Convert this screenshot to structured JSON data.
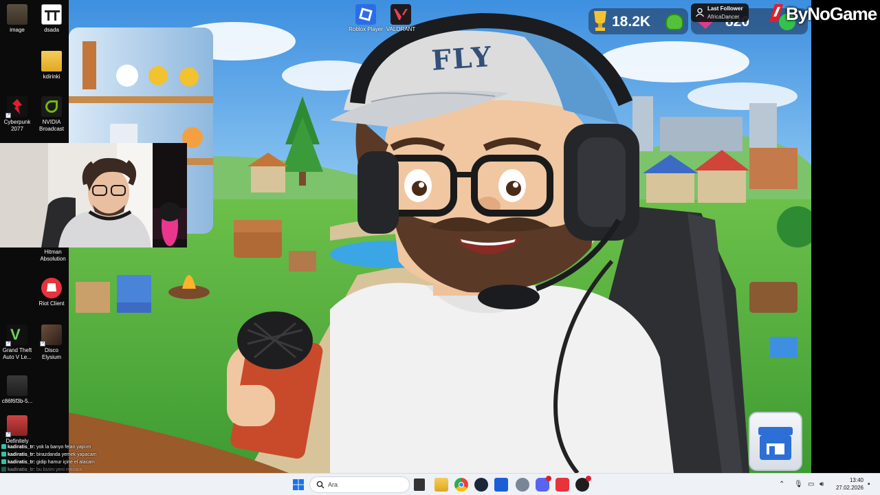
{
  "desktop_left_icons": [
    {
      "label": "image",
      "icon": "image-file-icon"
    },
    {
      "label": "dsada",
      "icon": "dsada-icon"
    },
    {
      "label": "kdirinki",
      "icon": "folder-icon"
    },
    {
      "label": "Cyberpunk 2077",
      "icon": "cyberpunk-icon"
    },
    {
      "label": "NVIDIA Broadcast",
      "icon": "nvidia-icon"
    },
    {
      "label": "Hitman Absolution",
      "icon": "hitman-icon"
    },
    {
      "label": "Riot Client",
      "icon": "riot-icon"
    },
    {
      "label": "Grand Theft Auto V Le...",
      "icon": "gta-icon"
    },
    {
      "label": "Disco Elysium",
      "icon": "disco-elysium-icon"
    },
    {
      "label": "c86f6f3b-5...",
      "icon": "image-file-icon"
    },
    {
      "label": "Definitely",
      "icon": "definitely-icon"
    }
  ],
  "desktop_top_icons": [
    {
      "label": "Roblox Player",
      "icon": "roblox-icon",
      "color": "#2b6de6"
    },
    {
      "label": "VALORANT",
      "icon": "valorant-icon",
      "color": "#e84057"
    }
  ],
  "hud": {
    "gold_value": "18.2K",
    "gem_value": "820"
  },
  "follower": {
    "title": "Last Follower",
    "name": "AfricaDancer"
  },
  "logo": {
    "text": "ByNoGame"
  },
  "scene": {
    "cap_text": "FLY"
  },
  "chat": [
    {
      "user": "kadiratis_tr:",
      "msg": "yok la banyo felan yapıım"
    },
    {
      "user": "kadiratis_tr:",
      "msg": "birazdanda yemek yapacam"
    },
    {
      "user": "kadiratis_tr:",
      "msg": "gidip hamur içine el alacam"
    },
    {
      "user": "kadiratis_tr:",
      "msg": "bu bizim yeni mecara"
    }
  ],
  "taskbar": {
    "search_placeholder": "Ara",
    "time": "13:40",
    "date": "27.02.2026"
  },
  "colors": {
    "taskbar_bg": "#eef1f6",
    "accent_blue": "#2b6de6",
    "hud_panel": "#1e3250"
  }
}
